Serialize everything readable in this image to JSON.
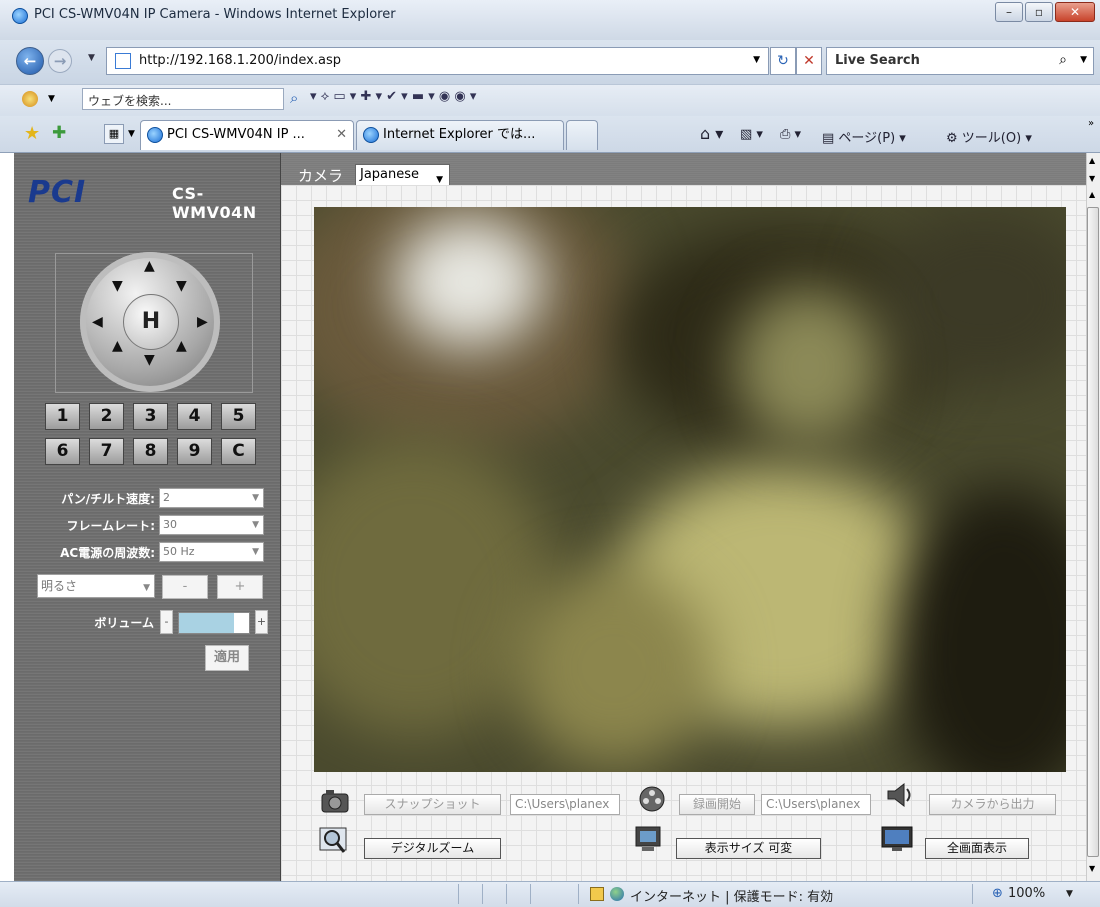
{
  "window": {
    "title": "PCI CS-WMV04N IP Camera - Windows Internet Explorer"
  },
  "address_bar": {
    "url": "http://192.168.1.200/index.asp",
    "search_placeholder": "Live Search"
  },
  "toolbar": {
    "web_search_placeholder": "ウェブを検索..."
  },
  "tabs": [
    {
      "label": "PCI CS-WMV04N IP ..."
    },
    {
      "label": "Internet Explorer では..."
    }
  ],
  "commands": {
    "page": "ページ(P)",
    "tools": "ツール(O)"
  },
  "camera": {
    "brand": "PCI",
    "model": "CS-WMV04N",
    "ptz_center": "H",
    "presets": [
      "1",
      "2",
      "3",
      "4",
      "5",
      "6",
      "7",
      "8",
      "9",
      "C"
    ],
    "settings": {
      "pan_tilt_speed": {
        "label": "パン/チルト速度:",
        "value": "2"
      },
      "frame_rate": {
        "label": "フレームレート:",
        "value": "30"
      },
      "ac_frequency": {
        "label": "AC電源の周波数:",
        "value": "50 Hz"
      },
      "brightness": {
        "value": "明るさ",
        "minus": "-",
        "plus": "+"
      },
      "volume": {
        "label": "ボリューム",
        "minus": "-",
        "plus": "+"
      },
      "apply": "適用"
    },
    "language": {
      "label": "カメラ",
      "value": "Japanese"
    },
    "controls": {
      "snapshot": "スナップショット",
      "snapshot_path": "C:\\Users\\planex",
      "record": "録画開始",
      "record_path": "C:\\Users\\planex",
      "audio_out": "カメラから出力",
      "digital_zoom": "デジタルズーム",
      "display_size": "表示サイズ 可変",
      "fullscreen": "全画面表示"
    }
  },
  "status_bar": {
    "zone": "インターネット | 保護モード: 有効",
    "zoom": "100%"
  },
  "colors": {
    "sidebar": "#6e6e6e",
    "brand_blue": "#1a3a8e",
    "volume_bar": "#a9d2e3"
  }
}
